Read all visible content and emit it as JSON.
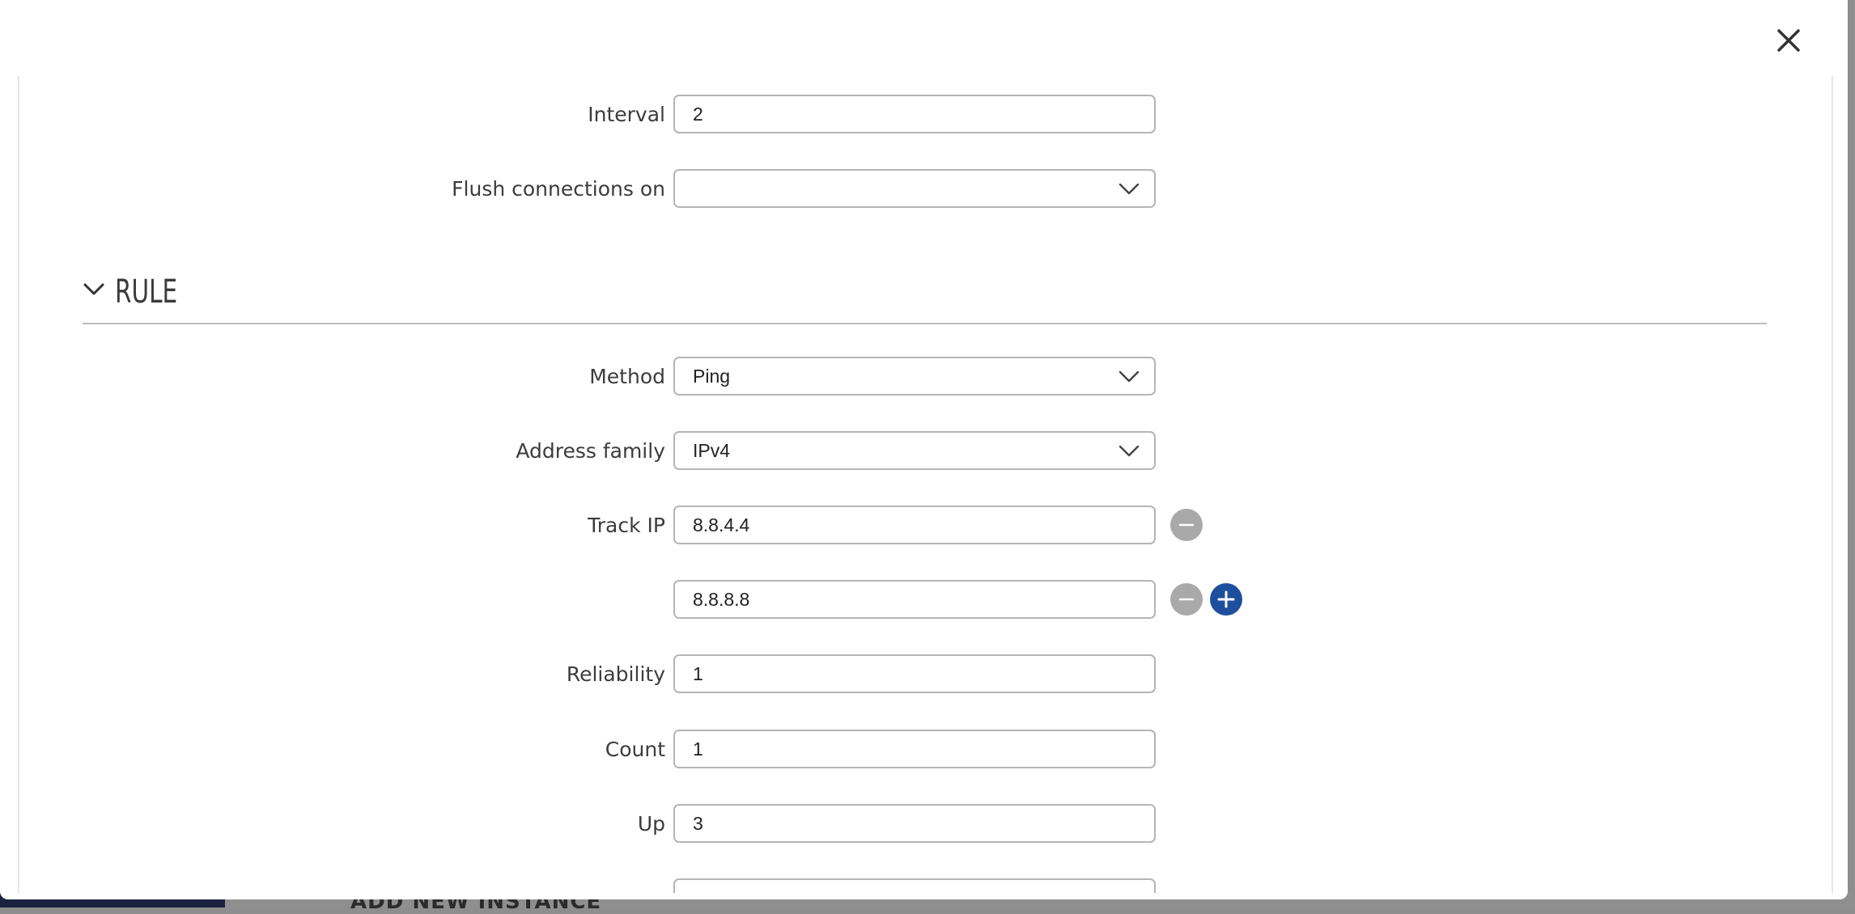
{
  "backdrop": {
    "heading": "ADD NEW INSTANCE"
  },
  "modal": {
    "close_icon": "close-icon",
    "top_fields": [
      {
        "label": "Interval",
        "value": "2",
        "type": "text"
      },
      {
        "label": "Flush connections on",
        "value": "",
        "type": "select"
      }
    ],
    "section": {
      "title": "RULE",
      "chevron_icon": "chevron-down-icon",
      "fields": {
        "method": {
          "label": "Method",
          "value": "Ping"
        },
        "address_family": {
          "label": "Address family",
          "value": "IPv4"
        },
        "track_ip": {
          "label": "Track IP",
          "values": [
            "8.8.4.4",
            "8.8.8.8"
          ]
        },
        "reliability": {
          "label": "Reliability",
          "value": "1"
        },
        "count": {
          "label": "Count",
          "value": "1"
        },
        "up": {
          "label": "Up",
          "value": "3"
        }
      }
    },
    "colors": {
      "add_button": "#1e4f9e",
      "remove_button": "#a9a9a9"
    }
  }
}
